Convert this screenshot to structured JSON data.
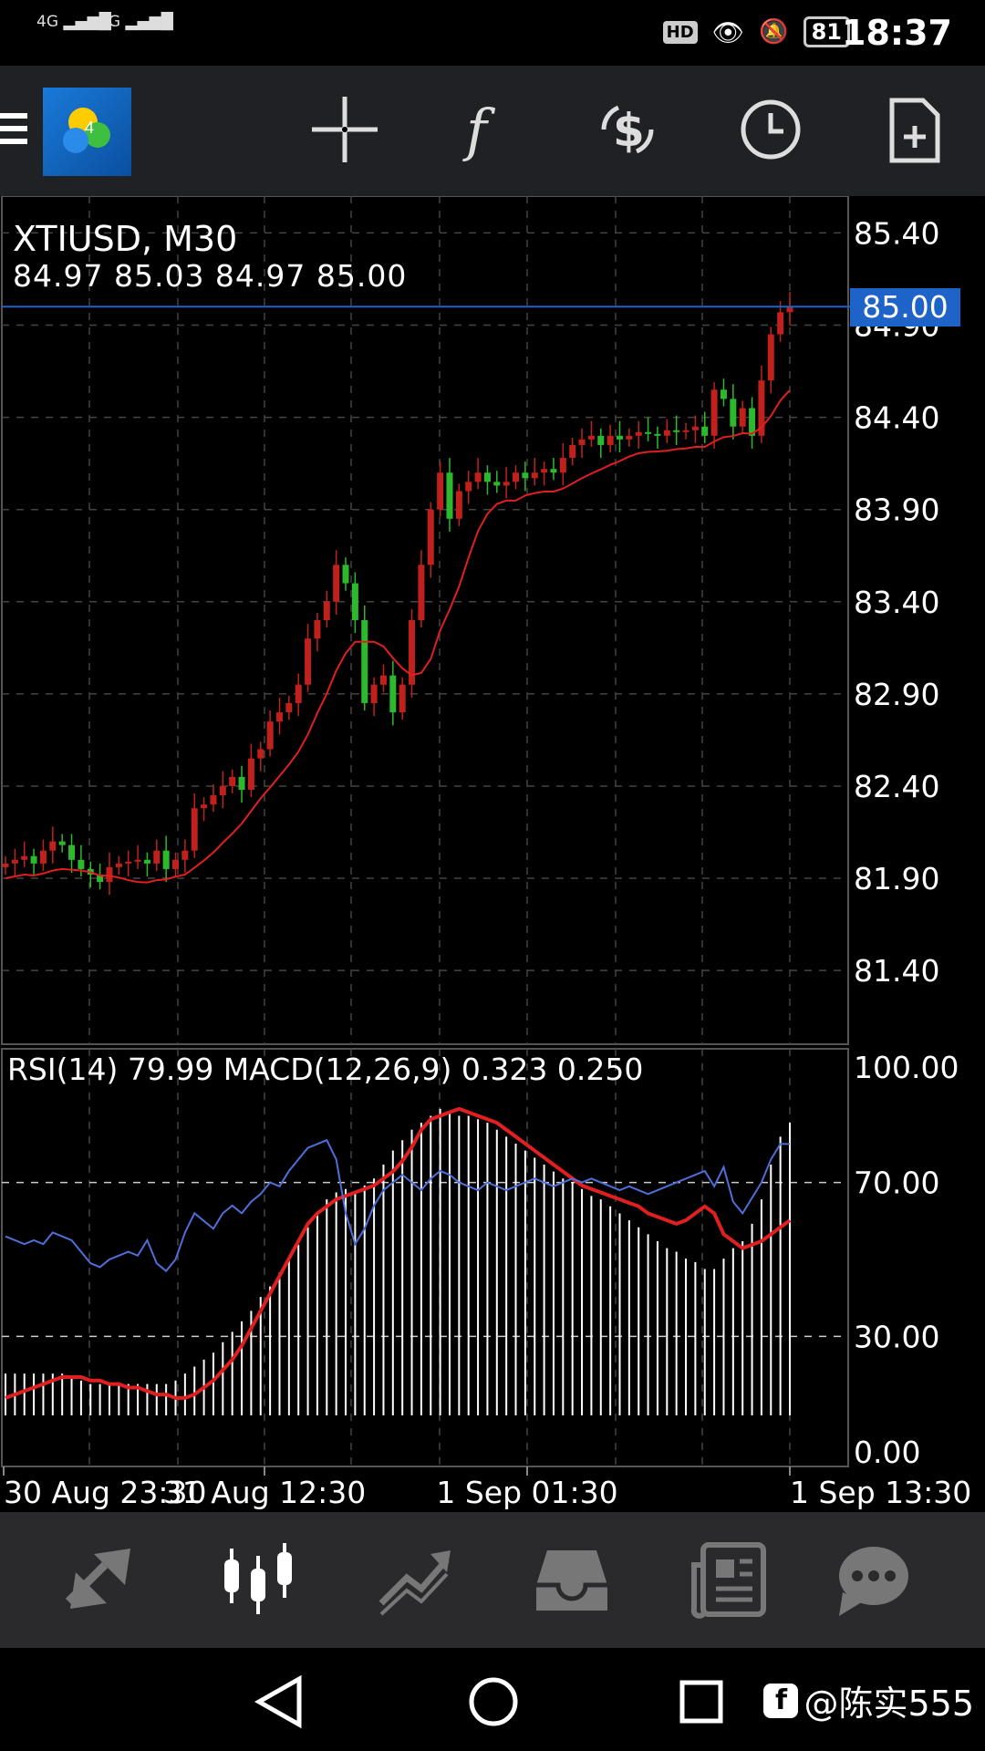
{
  "status_bar": {
    "signal_1": "4G",
    "signal_2": "2G",
    "hd": "HD",
    "battery": "81",
    "time": "18:37"
  },
  "toolbar": {
    "icons": [
      "menu-icon",
      "app-logo",
      "crosshair-icon",
      "function-icon",
      "trade-icon",
      "clock-icon",
      "new-document-icon"
    ]
  },
  "chart": {
    "symbol_timeframe": "XTIUSD, M30",
    "ohlc": "84.97 85.03 84.97 85.00",
    "current_price": "85.00",
    "indicators_label": "RSI(14) 79.99 MACD(12,26,9) 0.323 0.250",
    "colors": {
      "bull": "#2db92d",
      "bear": "#c0211c",
      "ma": "#e02020",
      "rsi": "#4f6fd8",
      "macd_signal": "#e02020",
      "price_line": "#1e63c8"
    }
  },
  "chart_data": [
    {
      "type": "candlestick",
      "title": "XTIUSD, M30",
      "y_ticks": [
        "85.40",
        "84.90",
        "84.40",
        "83.90",
        "83.40",
        "82.90",
        "82.40",
        "81.90",
        "81.40"
      ],
      "ylim": [
        81.0,
        85.6
      ],
      "x_ticks": [
        "30 Aug 23:30",
        "31 Aug 12:30",
        "1 Sep 01:30",
        "1 Sep 13:30"
      ],
      "close": [
        81.98,
        82.0,
        82.02,
        81.98,
        82.05,
        82.1,
        82.08,
        82.0,
        81.95,
        81.92,
        81.88,
        81.96,
        81.98,
        81.99,
        82.0,
        81.98,
        82.05,
        81.95,
        82.0,
        82.05,
        82.28,
        82.3,
        82.35,
        82.4,
        82.45,
        82.38,
        82.55,
        82.6,
        82.75,
        82.8,
        82.85,
        82.95,
        83.2,
        83.3,
        83.4,
        83.6,
        83.5,
        83.3,
        82.85,
        82.95,
        83.0,
        82.8,
        82.95,
        83.3,
        83.6,
        83.9,
        84.1,
        83.85,
        84.0,
        84.05,
        84.1,
        84.05,
        84.03,
        84.05,
        84.1,
        84.07,
        84.1,
        84.12,
        84.1,
        84.18,
        84.25,
        84.28,
        84.3,
        84.25,
        84.3,
        84.28,
        84.3,
        84.32,
        84.31,
        84.3,
        84.33,
        84.32,
        84.33,
        84.35,
        84.3,
        84.55,
        84.5,
        84.35,
        84.45,
        84.3,
        84.6,
        84.85,
        84.97,
        85.0
      ]
    },
    {
      "type": "line",
      "y_ticks": [
        "100.00",
        "70.00",
        "30.00",
        "0.00"
      ],
      "ylim": [
        0,
        100
      ],
      "rsi": [
        56,
        55,
        54,
        55,
        54,
        57,
        56,
        55,
        52,
        49,
        48,
        50,
        51,
        52,
        51,
        55,
        49,
        47,
        50,
        57,
        62,
        60,
        58,
        62,
        64,
        62,
        65,
        67,
        70,
        69,
        73,
        76,
        79,
        80,
        81,
        76,
        62,
        54,
        58,
        64,
        68,
        70,
        72,
        70,
        68,
        71,
        73,
        72,
        70,
        69,
        68,
        70,
        69,
        68,
        69,
        70,
        71,
        70,
        69,
        70,
        71,
        70,
        71,
        70,
        69,
        68,
        69,
        68,
        67,
        68,
        69,
        70,
        71,
        72,
        73,
        69,
        74,
        65,
        62,
        66,
        70,
        76,
        80,
        80
      ],
      "macd": [
        12,
        12,
        12,
        12,
        12,
        12,
        12,
        11,
        10,
        9,
        9,
        9,
        9,
        9,
        9,
        9,
        9,
        9,
        10,
        12,
        14,
        16,
        18,
        21,
        24,
        27,
        30,
        34,
        37,
        41,
        45,
        49,
        54,
        58,
        62,
        64,
        65,
        64,
        66,
        68,
        72,
        76,
        79,
        82,
        84,
        86,
        88,
        87,
        86,
        86,
        85,
        84,
        82,
        80,
        78,
        76,
        74,
        72,
        70,
        68,
        67,
        65,
        63,
        62,
        60,
        58,
        56,
        54,
        52,
        50,
        48,
        47,
        45,
        44,
        42,
        42,
        45,
        48,
        50,
        55,
        62,
        72,
        80,
        84
      ],
      "signal": [
        5,
        6,
        7,
        8,
        9,
        10,
        11,
        11,
        11,
        10,
        10,
        9,
        9,
        8,
        8,
        7,
        6,
        6,
        5,
        5,
        6,
        8,
        10,
        13,
        16,
        20,
        25,
        30,
        35,
        40,
        45,
        50,
        55,
        58,
        60,
        62,
        63,
        64,
        65,
        66,
        68,
        70,
        73,
        77,
        82,
        85,
        86,
        87,
        88,
        87,
        86,
        85,
        84,
        82,
        80,
        78,
        76,
        74,
        72,
        70,
        68,
        66,
        65,
        64,
        63,
        62,
        61,
        60,
        58,
        57,
        56,
        55,
        56,
        58,
        60,
        58,
        52,
        50,
        48,
        49,
        50,
        52,
        54,
        56
      ]
    }
  ],
  "bottom_nav": {
    "tabs": [
      "quotes-icon",
      "chart-icon",
      "trade-icon",
      "history-icon",
      "news-icon",
      "messages-icon"
    ]
  },
  "system_nav": {
    "watermark": "@陈实555"
  }
}
